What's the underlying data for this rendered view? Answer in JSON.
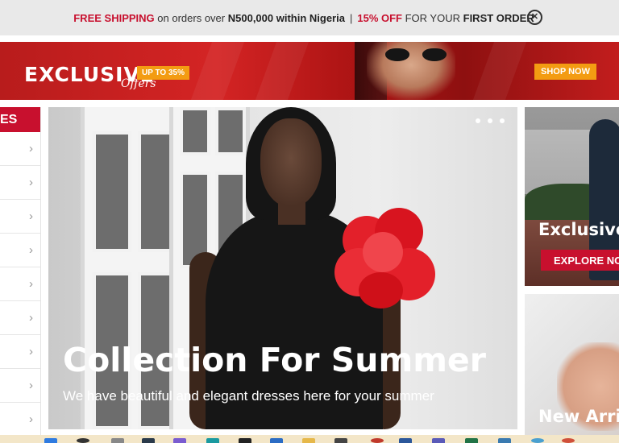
{
  "announcement": {
    "free_shipping": "FREE SHIPPING",
    "on_orders": "on orders over",
    "amount": "N500,000 within Nigeria",
    "separator": "|",
    "discount": "15% OFF",
    "for_your": "FOR YOUR",
    "first_order": "FIRST ORDER",
    "close_glyph": "✕"
  },
  "promo": {
    "headline": "EXCLUSIVE",
    "script": "Offers",
    "badge": "UP TO 35%",
    "cta": "SHOP NOW"
  },
  "sidebar": {
    "header": "ES",
    "chevron": "›",
    "items": 9
  },
  "hero": {
    "title": "Collection For Summer",
    "subtitle": "We have beautiful and elegant dresses here for your summer",
    "slides": 3
  },
  "cards": [
    {
      "title": "Exclusive",
      "button": "EXPLORE NO"
    },
    {
      "title": "New Arri"
    }
  ],
  "colors": {
    "brand_red": "#c8102e",
    "accent_orange": "#f39c12",
    "bar_gray": "#e9e9e9"
  }
}
